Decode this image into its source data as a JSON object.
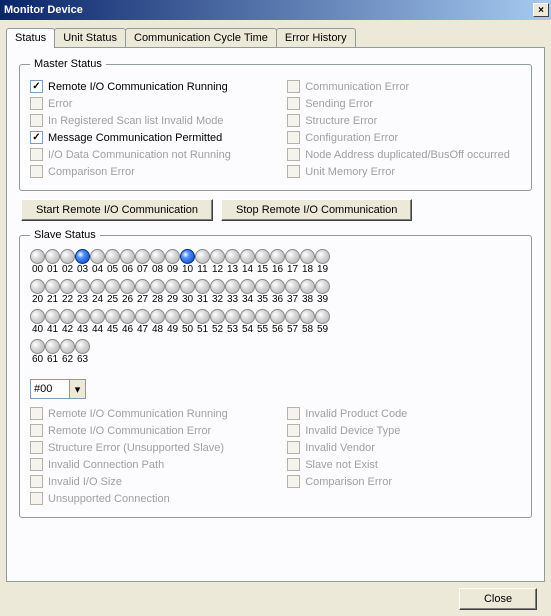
{
  "title": "Monitor Device",
  "tabs": [
    "Status",
    "Unit Status",
    "Communication Cycle Time",
    "Error History"
  ],
  "active_tab": 0,
  "master_status": {
    "legend": "Master Status",
    "left": [
      {
        "label": "Remote I/O Communication Running",
        "checked": true,
        "enabled": true
      },
      {
        "label": "Error",
        "checked": false,
        "enabled": false
      },
      {
        "label": "In Registered Scan list Invalid Mode",
        "checked": false,
        "enabled": false
      },
      {
        "label": "Message Communication Permitted",
        "checked": true,
        "enabled": true
      },
      {
        "label": "I/O Data Communication not Running",
        "checked": false,
        "enabled": false
      },
      {
        "label": "Comparison Error",
        "checked": false,
        "enabled": false
      }
    ],
    "right": [
      {
        "label": "Communication Error",
        "checked": false,
        "enabled": false
      },
      {
        "label": "Sending Error",
        "checked": false,
        "enabled": false
      },
      {
        "label": "Structure Error",
        "checked": false,
        "enabled": false
      },
      {
        "label": "Configuration Error",
        "checked": false,
        "enabled": false
      },
      {
        "label": "Node Address duplicated/BusOff occurred",
        "checked": false,
        "enabled": false
      },
      {
        "label": "Unit Memory Error",
        "checked": false,
        "enabled": false
      }
    ]
  },
  "buttons": {
    "start": "Start Remote I/O Communication",
    "stop": "Stop Remote I/O Communication"
  },
  "slave_status": {
    "legend": "Slave Status",
    "active_nodes": [
      3,
      10
    ],
    "node_count": 64,
    "selected": "#00",
    "left": [
      {
        "label": "Remote I/O Communication Running"
      },
      {
        "label": "Remote I/O Communication Error"
      },
      {
        "label": "Structure Error (Unsupported Slave)"
      },
      {
        "label": "Invalid Connection Path"
      },
      {
        "label": "Invalid I/O Size"
      },
      {
        "label": "Unsupported Connection"
      }
    ],
    "right": [
      {
        "label": "Invalid Product Code"
      },
      {
        "label": "Invalid Device Type"
      },
      {
        "label": "Invalid Vendor"
      },
      {
        "label": "Slave not Exist"
      },
      {
        "label": "Comparison Error"
      }
    ]
  },
  "footer": {
    "close": "Close"
  }
}
